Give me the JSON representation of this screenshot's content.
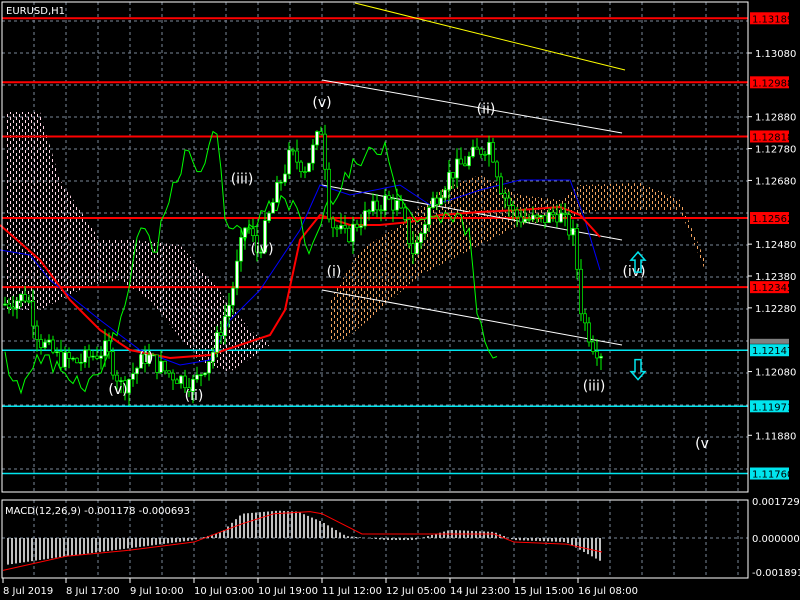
{
  "window": {
    "symbol_timeframe": "EURUSD,H1"
  },
  "colors": {
    "background": "#000000",
    "grid": "#7a8799",
    "resistance": "#ff0000",
    "support": "#00e5ee",
    "candle": "#00ff00",
    "cloud_bull": "#f4a460",
    "cloud_bear": "#ffd7e6",
    "ma_red": "#ff0000",
    "ma_blue": "#0000ff",
    "chikou": "#00ff00",
    "trend_yellow": "#ffff00",
    "trend_white": "#ffffff",
    "macd_hist": "#c0c0c0",
    "macd_signal": "#ff0000"
  },
  "chart_data": [
    {
      "type": "candlestick",
      "title": "EURUSD,H1",
      "ylim": [
        1.1172,
        1.1323
      ],
      "grid": true,
      "y_ticks": [
        "1.13080",
        "1.12880",
        "1.12780",
        "1.12680",
        "1.12480",
        "1.12380",
        "1.12280",
        "1.12080",
        "1.11880"
      ],
      "x_ticks": [
        "8 Jul 2019",
        "8 Jul 17:00",
        "9 Jul 10:00",
        "10 Jul 03:00",
        "10 Jul 19:00",
        "11 Jul 12:00",
        "12 Jul 05:00",
        "14 Jul 23:00",
        "15 Jul 15:00",
        "16 Jul 08:00"
      ],
      "price_path": [
        [
          "8 Jul 00:00",
          1.1229
        ],
        [
          "8 Jul 06:00",
          1.1232
        ],
        [
          "8 Jul 09:00",
          1.1218
        ],
        [
          "8 Jul 14:00",
          1.1212
        ],
        [
          "8 Jul 20:00",
          1.1211
        ],
        [
          "9 Jul 03:00",
          1.1215
        ],
        [
          "9 Jul 07:00",
          1.1203
        ],
        [
          "9 Jul 14:00",
          1.1213
        ],
        [
          "9 Jul 19:00",
          1.1208
        ],
        [
          "10 Jul 03:00",
          1.1204
        ],
        [
          "10 Jul 08:00",
          1.1215
        ],
        [
          "10 Jul 12:00",
          1.123
        ],
        [
          "10 Jul 16:00",
          1.1255
        ],
        [
          "10 Jul 19:00",
          1.1245
        ],
        [
          "10 Jul 23:00",
          1.1262
        ],
        [
          "11 Jul 03:00",
          1.1276
        ],
        [
          "11 Jul 07:00",
          1.1272
        ],
        [
          "11 Jul 12:00",
          1.1285
        ],
        [
          "11 Jul 14:00",
          1.1255
        ],
        [
          "11 Jul 18:00",
          1.125
        ],
        [
          "11 Jul 21:00",
          1.1255
        ],
        [
          "12 Jul 05:00",
          1.1262
        ],
        [
          "12 Jul 08:00",
          1.126
        ],
        [
          "12 Jul 12:00",
          1.1245
        ],
        [
          "12 Jul 16:00",
          1.126
        ],
        [
          "14 Jul 23:00",
          1.127
        ],
        [
          "15 Jul 04:00",
          1.1275
        ],
        [
          "15 Jul 09:00",
          1.128
        ],
        [
          "15 Jul 12:00",
          1.1265
        ],
        [
          "15 Jul 15:00",
          1.1257
        ],
        [
          "15 Jul 21:00",
          1.1255
        ],
        [
          "16 Jul 02:00",
          1.1258
        ],
        [
          "16 Jul 06:00",
          1.125
        ],
        [
          "16 Jul 09:00",
          1.1225
        ],
        [
          "16 Jul 12:00",
          1.1216
        ],
        [
          "16 Jul 14:00",
          1.1214
        ]
      ],
      "levels": [
        {
          "price": "1.13189",
          "kind": "resistance"
        },
        {
          "price": "1.12988",
          "kind": "resistance"
        },
        {
          "price": "1.12818",
          "kind": "resistance"
        },
        {
          "price": "1.12562",
          "kind": "resistance"
        },
        {
          "price": "1.12345",
          "kind": "resistance"
        },
        {
          "price": "1.12147",
          "kind": "support"
        },
        {
          "price": "1.11971",
          "kind": "support"
        },
        {
          "price": "1.11760",
          "kind": "support"
        }
      ],
      "wave_labels": [
        {
          "text": "(v)",
          "time": "11 Jul 12:00",
          "price": 1.1291
        },
        {
          "text": "(ii)",
          "time": "15 Jul 08:00",
          "price": 1.1289
        },
        {
          "text": "(iii)",
          "time": "10 Jul 15:00",
          "price": 1.1267
        },
        {
          "text": "(iv)",
          "time": "10 Jul 20:00",
          "price": 1.1245
        },
        {
          "text": "(i)",
          "time": "11 Jul 15:00",
          "price": 1.1238
        },
        {
          "text": "(iv)",
          "time": "16 Jul 22:00",
          "price": 1.1238
        },
        {
          "text": "(iii)",
          "time": "16 Jul 12:00",
          "price": 1.1202
        },
        {
          "text": "(i)",
          "time": "9 Jul 14:00",
          "price": 1.1211
        },
        {
          "text": "(v)",
          "time": "9 Jul 06:00",
          "price": 1.1201
        },
        {
          "text": "(ii)",
          "time": "10 Jul 02:00",
          "price": 1.1199
        },
        {
          "text": "(v",
          "time": "17 Jul 15:00",
          "price": 1.1184
        }
      ],
      "arrows": [
        {
          "direction": "up",
          "time": "16 Jul 23:00",
          "price": 1.1243
        },
        {
          "direction": "down",
          "time": "16 Jul 23:00",
          "price": 1.1208
        }
      ]
    },
    {
      "type": "bar+line",
      "title": "MACD(12,26,9) -0.001178 -0.000693",
      "ylim": [
        -0.001891,
        0.001729
      ],
      "y_ticks": [
        "0.001729",
        "0.000000",
        "-0.001891"
      ],
      "histogram_path": [
        [
          "8 Jul 00:00",
          -0.00135
        ],
        [
          "8 Jul 17:00",
          -0.0009
        ],
        [
          "9 Jul 10:00",
          -0.0005
        ],
        [
          "10 Jul 03:00",
          -0.0001
        ],
        [
          "10 Jul 10:00",
          0.0003
        ],
        [
          "10 Jul 15:00",
          0.0012
        ],
        [
          "11 Jul 00:00",
          0.00135
        ],
        [
          "11 Jul 05:00",
          0.0013
        ],
        [
          "11 Jul 12:00",
          0.0008
        ],
        [
          "11 Jul 18:00",
          0.0001
        ],
        [
          "12 Jul 05:00",
          -0.0001
        ],
        [
          "12 Jul 12:00",
          -0.0001
        ],
        [
          "14 Jul 23:00",
          0.0004
        ],
        [
          "15 Jul 10:00",
          0.0003
        ],
        [
          "15 Jul 15:00",
          -0.0001
        ],
        [
          "16 Jul 04:00",
          -0.0002
        ],
        [
          "16 Jul 14:00",
          -0.001178
        ]
      ],
      "signal_path": [
        [
          "8 Jul 00:00",
          -0.0016
        ],
        [
          "8 Jul 17:00",
          -0.0009
        ],
        [
          "9 Jul 10:00",
          -0.0006
        ],
        [
          "10 Jul 03:00",
          -0.0002
        ],
        [
          "10 Jul 15:00",
          0.0007
        ],
        [
          "10 Jul 23:00",
          0.0012
        ],
        [
          "11 Jul 08:00",
          0.0013
        ],
        [
          "11 Jul 12:00",
          0.0012
        ],
        [
          "11 Jul 22:00",
          0.0002
        ],
        [
          "12 Jul 05:00",
          0.0002
        ],
        [
          "14 Jul 23:00",
          0.0002
        ],
        [
          "15 Jul 10:00",
          0.0002
        ],
        [
          "15 Jul 15:00",
          -0.0002
        ],
        [
          "16 Jul 04:00",
          -0.0003
        ],
        [
          "16 Jul 14:00",
          -0.000693
        ]
      ]
    }
  ]
}
